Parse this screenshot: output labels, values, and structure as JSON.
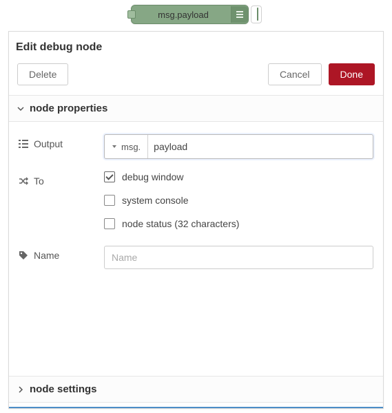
{
  "node": {
    "label": "msg.payload"
  },
  "panel": {
    "title": "Edit debug node",
    "buttons": {
      "delete": "Delete",
      "cancel": "Cancel",
      "done": "Done"
    }
  },
  "sections": {
    "properties": {
      "label": "node properties",
      "expanded": true
    },
    "settings": {
      "label": "node settings",
      "expanded": false
    }
  },
  "form": {
    "output": {
      "label": "Output",
      "type_label": "msg.",
      "value": "payload"
    },
    "to": {
      "label": "To",
      "debug_window": {
        "label": "debug window",
        "checked": true
      },
      "system_console": {
        "label": "system console",
        "checked": false
      },
      "node_status": {
        "label": "node status (32 characters)",
        "checked": false
      }
    },
    "name": {
      "label": "Name",
      "placeholder": "Name",
      "value": ""
    }
  }
}
